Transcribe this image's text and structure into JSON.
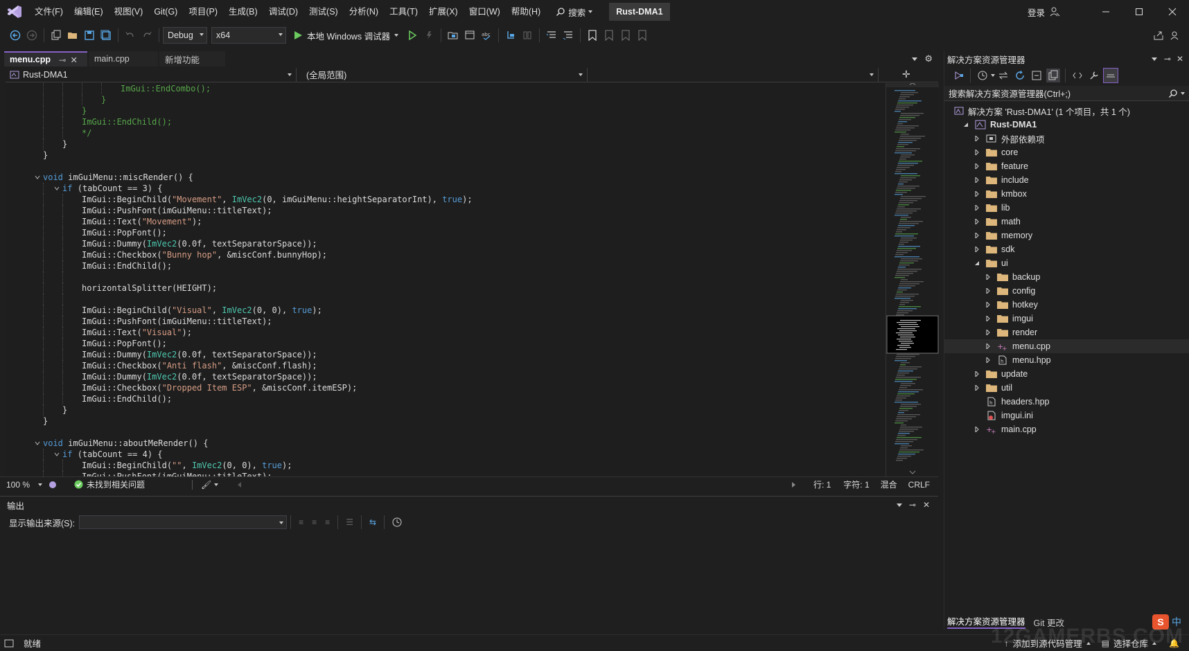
{
  "app": {
    "title_badge": "Rust-DMA1",
    "menu": [
      "文件(F)",
      "编辑(E)",
      "视图(V)",
      "Git(G)",
      "项目(P)",
      "生成(B)",
      "调试(D)",
      "测试(S)",
      "分析(N)",
      "工具(T)",
      "扩展(X)",
      "窗口(W)",
      "帮助(H)"
    ],
    "search_label": "搜索",
    "login_label": "登录"
  },
  "toolbar": {
    "config_value": "Debug",
    "platform_value": "x64",
    "run_label": "本地 Windows 调试器"
  },
  "editor": {
    "tabs": [
      "menu.cpp",
      "main.cpp",
      "新增功能"
    ],
    "project_combo": "Rust-DMA1",
    "scope_combo": "(全局范围)",
    "zoom": "100 %",
    "issues": "未找到相关问题",
    "line": "行: 1",
    "char": "字符: 1",
    "mixed": "混合",
    "eol": "CRLF"
  },
  "code_lines": [
    {
      "indent": 4,
      "parts": [
        [
          "cmt",
          "ImGui::EndCombo();"
        ]
      ]
    },
    {
      "indent": 3,
      "parts": [
        [
          "cmt",
          "}"
        ]
      ]
    },
    {
      "indent": 2,
      "parts": [
        [
          "cmt",
          "}"
        ]
      ]
    },
    {
      "indent": 2,
      "parts": [
        [
          "cmt",
          "ImGui::EndChild();"
        ]
      ]
    },
    {
      "indent": 2,
      "parts": [
        [
          "cmt",
          "*/"
        ]
      ]
    },
    {
      "indent": 1,
      "parts": [
        [
          "",
          "}"
        ]
      ]
    },
    {
      "indent": 0,
      "parts": [
        [
          "",
          "}"
        ]
      ]
    },
    {
      "indent": 0,
      "parts": []
    },
    {
      "indent": 0,
      "fold": true,
      "parts": [
        [
          "kw",
          "void "
        ],
        [
          "",
          "imGuiMenu::miscRender() {"
        ]
      ]
    },
    {
      "indent": 1,
      "fold": true,
      "parts": [
        [
          "kw",
          "if "
        ],
        [
          "",
          "(tabCount == 3) {"
        ]
      ]
    },
    {
      "indent": 2,
      "parts": [
        [
          "",
          "ImGui::BeginChild("
        ],
        [
          "str",
          "\"Movement\""
        ],
        [
          "",
          ", "
        ],
        [
          "cls",
          "ImVec2"
        ],
        [
          "",
          "(0, imGuiMenu::heightSeparatorInt), "
        ],
        [
          "kw",
          "true"
        ],
        [
          "",
          ");"
        ]
      ]
    },
    {
      "indent": 2,
      "parts": [
        [
          "",
          "ImGui::PushFont(imGuiMenu::titleText);"
        ]
      ]
    },
    {
      "indent": 2,
      "parts": [
        [
          "",
          "ImGui::Text("
        ],
        [
          "str",
          "\"Movement\""
        ],
        [
          "",
          ");"
        ]
      ]
    },
    {
      "indent": 2,
      "parts": [
        [
          "",
          "ImGui::PopFont();"
        ]
      ]
    },
    {
      "indent": 2,
      "parts": [
        [
          "",
          "ImGui::Dummy("
        ],
        [
          "cls",
          "ImVec2"
        ],
        [
          "",
          "(0.0f, textSeparatorSpace));"
        ]
      ]
    },
    {
      "indent": 2,
      "parts": [
        [
          "",
          "ImGui::Checkbox("
        ],
        [
          "str",
          "\"Bunny hop\""
        ],
        [
          "",
          ", &miscConf.bunnyHop);"
        ]
      ]
    },
    {
      "indent": 2,
      "parts": [
        [
          "",
          "ImGui::EndChild();"
        ]
      ]
    },
    {
      "indent": 2,
      "parts": []
    },
    {
      "indent": 2,
      "parts": [
        [
          "",
          "horizontalSplitter(HEIGHT);"
        ]
      ]
    },
    {
      "indent": 2,
      "parts": []
    },
    {
      "indent": 2,
      "parts": [
        [
          "",
          "ImGui::BeginChild("
        ],
        [
          "str",
          "\"Visual\""
        ],
        [
          "",
          ", "
        ],
        [
          "cls",
          "ImVec2"
        ],
        [
          "",
          "(0, 0), "
        ],
        [
          "kw",
          "true"
        ],
        [
          "",
          ");"
        ]
      ]
    },
    {
      "indent": 2,
      "parts": [
        [
          "",
          "ImGui::PushFont(imGuiMenu::titleText);"
        ]
      ]
    },
    {
      "indent": 2,
      "parts": [
        [
          "",
          "ImGui::Text("
        ],
        [
          "str",
          "\"Visual\""
        ],
        [
          "",
          ");"
        ]
      ]
    },
    {
      "indent": 2,
      "parts": [
        [
          "",
          "ImGui::PopFont();"
        ]
      ]
    },
    {
      "indent": 2,
      "parts": [
        [
          "",
          "ImGui::Dummy("
        ],
        [
          "cls",
          "ImVec2"
        ],
        [
          "",
          "(0.0f, textSeparatorSpace));"
        ]
      ]
    },
    {
      "indent": 2,
      "parts": [
        [
          "",
          "ImGui::Checkbox("
        ],
        [
          "str",
          "\"Anti flash\""
        ],
        [
          "",
          ", &miscConf.flash);"
        ]
      ]
    },
    {
      "indent": 2,
      "parts": [
        [
          "",
          "ImGui::Dummy("
        ],
        [
          "cls",
          "ImVec2"
        ],
        [
          "",
          "(0.0f, textSeparatorSpace));"
        ]
      ]
    },
    {
      "indent": 2,
      "parts": [
        [
          "",
          "ImGui::Checkbox("
        ],
        [
          "str",
          "\"Dropped Item ESP\""
        ],
        [
          "",
          ", &miscConf.itemESP);"
        ]
      ]
    },
    {
      "indent": 2,
      "parts": [
        [
          "",
          "ImGui::EndChild();"
        ]
      ]
    },
    {
      "indent": 1,
      "parts": [
        [
          "",
          "}"
        ]
      ]
    },
    {
      "indent": 0,
      "parts": [
        [
          "",
          "}"
        ]
      ]
    },
    {
      "indent": 0,
      "parts": []
    },
    {
      "indent": 0,
      "fold": true,
      "parts": [
        [
          "kw",
          "void "
        ],
        [
          "",
          "imGuiMenu::aboutMeRender() {"
        ]
      ]
    },
    {
      "indent": 1,
      "fold": true,
      "parts": [
        [
          "kw",
          "if "
        ],
        [
          "",
          "(tabCount == 4) {"
        ]
      ]
    },
    {
      "indent": 2,
      "parts": [
        [
          "",
          "ImGui::BeginChild("
        ],
        [
          "str",
          "\"\""
        ],
        [
          "",
          ", "
        ],
        [
          "cls",
          "ImVec2"
        ],
        [
          "",
          "(0, 0), "
        ],
        [
          "kw",
          "true"
        ],
        [
          "",
          ");"
        ]
      ]
    },
    {
      "indent": 2,
      "parts": [
        [
          "",
          "ImGui::PushFont(imGuiMenu::titleText);"
        ]
      ]
    }
  ],
  "output": {
    "title": "输出",
    "source_label": "显示输出来源(S):"
  },
  "solution": {
    "title": "解决方案资源管理器",
    "search_placeholder": "搜索解决方案资源管理器(Ctrl+;)",
    "root": "解决方案 'Rust-DMA1' (1 个项目，共 1 个)",
    "tree": [
      {
        "label": "Rust-DMA1",
        "level": 1,
        "kind": "project",
        "exp": "open",
        "bold": true
      },
      {
        "label": "外部依赖项",
        "level": 2,
        "kind": "deps",
        "exp": "closed"
      },
      {
        "label": "core",
        "level": 2,
        "kind": "folder",
        "exp": "closed"
      },
      {
        "label": "feature",
        "level": 2,
        "kind": "folder",
        "exp": "closed"
      },
      {
        "label": "include",
        "level": 2,
        "kind": "folder",
        "exp": "closed"
      },
      {
        "label": "kmbox",
        "level": 2,
        "kind": "folder",
        "exp": "closed"
      },
      {
        "label": "lib",
        "level": 2,
        "kind": "folder",
        "exp": "closed"
      },
      {
        "label": "math",
        "level": 2,
        "kind": "folder",
        "exp": "closed"
      },
      {
        "label": "memory",
        "level": 2,
        "kind": "folder",
        "exp": "closed"
      },
      {
        "label": "sdk",
        "level": 2,
        "kind": "folder",
        "exp": "closed"
      },
      {
        "label": "ui",
        "level": 2,
        "kind": "folder",
        "exp": "open"
      },
      {
        "label": "backup",
        "level": 3,
        "kind": "folder",
        "exp": "closed"
      },
      {
        "label": "config",
        "level": 3,
        "kind": "folder",
        "exp": "closed"
      },
      {
        "label": "hotkey",
        "level": 3,
        "kind": "folder",
        "exp": "closed"
      },
      {
        "label": "imgui",
        "level": 3,
        "kind": "folder",
        "exp": "closed"
      },
      {
        "label": "render",
        "level": 3,
        "kind": "folder",
        "exp": "closed"
      },
      {
        "label": "menu.cpp",
        "level": 3,
        "kind": "cpp",
        "exp": "closed",
        "selected": true
      },
      {
        "label": "menu.hpp",
        "level": 3,
        "kind": "hpp",
        "exp": "closed"
      },
      {
        "label": "update",
        "level": 2,
        "kind": "folder",
        "exp": "closed"
      },
      {
        "label": "util",
        "level": 2,
        "kind": "folder",
        "exp": "closed"
      },
      {
        "label": "headers.hpp",
        "level": 2,
        "kind": "hpp",
        "exp": "none"
      },
      {
        "label": "imgui.ini",
        "level": 2,
        "kind": "ini",
        "exp": "none"
      },
      {
        "label": "main.cpp",
        "level": 2,
        "kind": "cpp",
        "exp": "closed"
      }
    ],
    "bottom_tabs": [
      "解决方案资源管理器",
      "Git 更改"
    ]
  },
  "status": {
    "ready": "就绪",
    "add_source": "添加到源代码管理",
    "select_repo": "选择仓库",
    "ime": "中",
    "watermark": "12GAMERBS.COM"
  },
  "colors": {
    "accent": "#8661c5",
    "folder": "#dcb67a",
    "run_green": "#6ccb5f"
  }
}
